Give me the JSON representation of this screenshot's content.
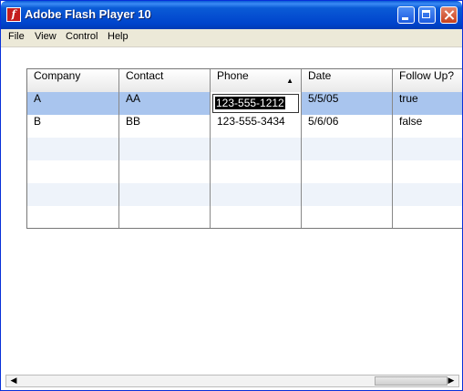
{
  "window": {
    "title": "Adobe Flash Player 10"
  },
  "menu": [
    "File",
    "View",
    "Control",
    "Help"
  ],
  "grid": {
    "columns": [
      "Company",
      "Contact",
      "Phone",
      "Date",
      "Follow Up?"
    ],
    "sort_column": "Phone",
    "rows": [
      {
        "company": "A",
        "contact": "AA",
        "phone": "123-555-1212",
        "date": "5/5/05",
        "follow_up": "true"
      },
      {
        "company": "B",
        "contact": "BB",
        "phone": "123-555-3434",
        "date": "5/6/06",
        "follow_up": "false"
      }
    ]
  },
  "icons": {
    "sort": "sort-ascending-icon",
    "scroll_left": "left-arrow-icon",
    "scroll_right": "right-arrow-icon"
  }
}
